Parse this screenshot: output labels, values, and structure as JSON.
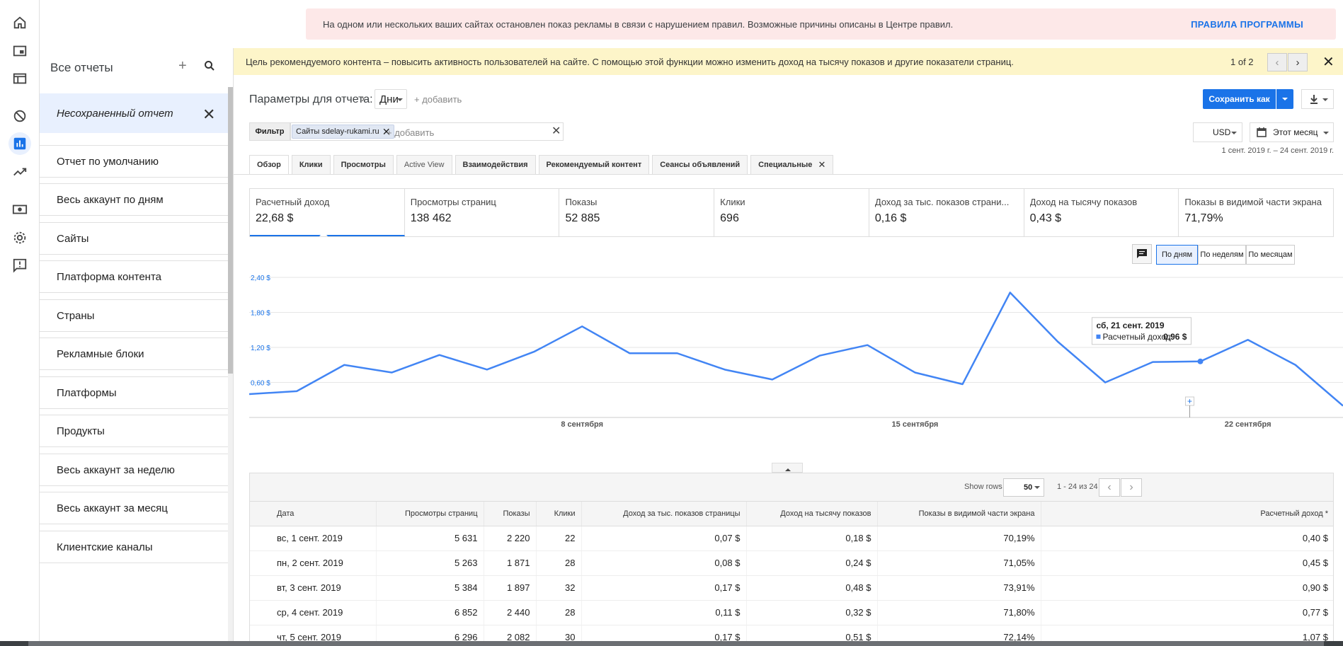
{
  "rail": {
    "icons": [
      "home-icon",
      "content-icon",
      "layout-icon",
      "block-icon",
      "reports-icon",
      "optimization-icon",
      "payments-icon",
      "settings-icon",
      "feedback-icon"
    ]
  },
  "alert": {
    "text": "На одном или нескольких ваших сайтах остановлен показ рекламы в связи с нарушением правил. Возможные причины описаны в Центре правил.",
    "link": "ПРАВИЛА ПРОГРАММЫ"
  },
  "notice": {
    "text": "Цель рекомендуемого контента – повысить активность пользователей на сайте. С помощью этой функции можно изменить доход на тысячу показов и другие показатели страниц.",
    "count": "1 of 2"
  },
  "reports": {
    "title": "Все отчеты",
    "current": "Несохраненный отчет",
    "items": [
      "Отчет по умолчанию",
      "Весь аккаунт по дням",
      "Сайты",
      "Платформа контента",
      "Страны",
      "Рекламные блоки",
      "Платформы",
      "Продукты",
      "Весь аккаунт за неделю",
      "Весь аккаунт за месяц",
      "Клиентские каналы"
    ]
  },
  "params": {
    "label": "Параметры для отчета:",
    "dimension": "Дни",
    "add": "+ добавить"
  },
  "filter": {
    "label": "Фильтр",
    "chip": "Сайты sdelay-rukami.ru",
    "add": "+ добавить"
  },
  "toolbar": {
    "save_label": "Сохранить как",
    "currency": "USD",
    "period": "Этот месяц",
    "range": "1 сент. 2019 г. – 24 сент. 2019 г."
  },
  "tabs": [
    {
      "label": "Обзор"
    },
    {
      "label": "Клики"
    },
    {
      "label": "Просмотры"
    },
    {
      "label": "Active View"
    },
    {
      "label": "Взаимодействия"
    },
    {
      "label": "Рекомендуемый контент"
    },
    {
      "label": "Сеансы объявлений"
    },
    {
      "label": "Специальные"
    }
  ],
  "metrics": [
    {
      "title": "Расчетный доход",
      "value": "22,68 $"
    },
    {
      "title": "Просмотры страниц",
      "value": "138 462"
    },
    {
      "title": "Показы",
      "value": "52 885"
    },
    {
      "title": "Клики",
      "value": "696"
    },
    {
      "title": "Доход за тыс. показов страни...",
      "value": "0,16 $"
    },
    {
      "title": "Доход на тысячу показов",
      "value": "0,43 $"
    },
    {
      "title": "Показы в видимой части экрана",
      "value": "71,79%"
    }
  ],
  "granularity": {
    "day": "По дням",
    "week": "По неделям",
    "month": "По месяцам"
  },
  "chart_data": {
    "type": "line",
    "x": [
      1,
      2,
      3,
      4,
      5,
      6,
      7,
      8,
      9,
      10,
      11,
      12,
      13,
      14,
      15,
      16,
      17,
      18,
      19,
      20,
      21,
      22,
      23,
      24
    ],
    "y_ticks": [
      "2,40 $",
      "1,80 $",
      "1,20 $",
      "0,60 $"
    ],
    "x_tick_labels": [
      {
        "x": 8,
        "label": "8 сентября"
      },
      {
        "x": 15,
        "label": "15 сентября"
      },
      {
        "x": 22,
        "label": "22 сентября"
      }
    ],
    "ylim": [
      0,
      2.4
    ],
    "color": "#4285f4",
    "series": [
      {
        "values": [
          0.4,
          0.45,
          0.9,
          0.77,
          1.07,
          0.82,
          1.13,
          1.56,
          1.1,
          1.1,
          0.82,
          0.65,
          1.06,
          1.24,
          0.77,
          0.57,
          2.14,
          1.3,
          0.6,
          0.95,
          0.96,
          1.33,
          0.9,
          0.2
        ]
      }
    ],
    "tooltip": {
      "x": 21,
      "date": "сб, 21 сент. 2019",
      "label": "Расчетный доход:",
      "value": "0,96 $"
    }
  },
  "table": {
    "show_rows_label": "Show rows",
    "rows_per_page": "50",
    "range": "1 - 24 из 24",
    "columns": [
      "Дата",
      "Просмотры страниц",
      "Показы",
      "Клики",
      "Доход за тыс. показов страницы",
      "Доход на тысячу показов",
      "Показы в видимой части экрана",
      "Расчетный доход *"
    ],
    "rows": [
      [
        "вс, 1 сент. 2019",
        "5 631",
        "2 220",
        "22",
        "0,07 $",
        "0,18 $",
        "70,19%",
        "0,40 $"
      ],
      [
        "пн, 2 сент. 2019",
        "5 263",
        "1 871",
        "28",
        "0,08 $",
        "0,24 $",
        "71,05%",
        "0,45 $"
      ],
      [
        "вт, 3 сент. 2019",
        "5 384",
        "1 897",
        "32",
        "0,17 $",
        "0,48 $",
        "73,91%",
        "0,90 $"
      ],
      [
        "ср, 4 сент. 2019",
        "6 852",
        "2 440",
        "28",
        "0,11 $",
        "0,32 $",
        "71,80%",
        "0,77 $"
      ],
      [
        "чт, 5 сент. 2019",
        "6 296",
        "2 082",
        "30",
        "0,17 $",
        "0,51 $",
        "72,14%",
        "1,07 $"
      ]
    ]
  }
}
